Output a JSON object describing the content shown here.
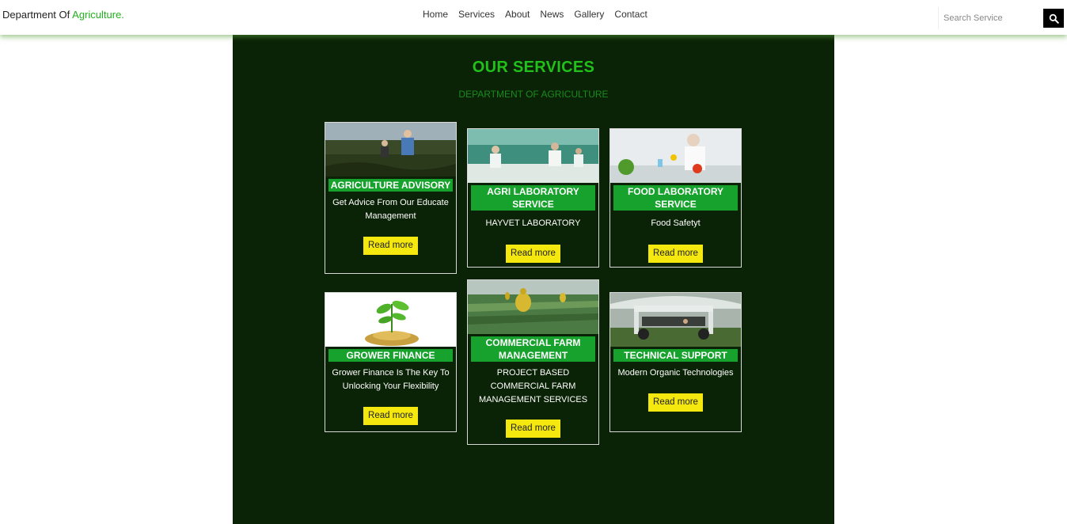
{
  "header": {
    "brand_prefix": "Department Of ",
    "brand_highlight": "Agriculture.",
    "nav": [
      "Home",
      "Services",
      "About",
      "News",
      "Gallery",
      "Contact"
    ],
    "search_placeholder": "Search Service"
  },
  "services": {
    "title": "OUR SERVICES",
    "subtitle": "DEPARTMENT OF AGRICULTURE",
    "cards": [
      {
        "title": "AGRICULTURE ADVISORY",
        "desc": "Get Advice From Our Educate Management",
        "button": "Read more"
      },
      {
        "title": "AGRI LABORATORY SERVICE",
        "desc": "HAYVET LABORATORY",
        "button": "Read more"
      },
      {
        "title": "FOOD LABORATORY SERVICE",
        "desc": "Food Safetyt",
        "button": "Read more"
      },
      {
        "title": "GROWER FINANCE",
        "desc": "Grower Finance Is The Key To Unlocking Your Flexibility",
        "button": "Read more"
      },
      {
        "title": "COMMERCIAL FARM MANAGEMENT",
        "desc": "PROJECT BASED COMMERCIAL FARM MANAGEMENT SERVICES",
        "button": "Read more"
      },
      {
        "title": "TECHNICAL SUPPORT",
        "desc": "Modern Organic Technologies",
        "button": "Read more"
      }
    ]
  },
  "colors": {
    "accent": "#22b01e",
    "section_bg": "#0a2205",
    "title_bar": "#16a22c",
    "button": "#f4e80e"
  },
  "icons": {
    "search": "search-icon"
  }
}
